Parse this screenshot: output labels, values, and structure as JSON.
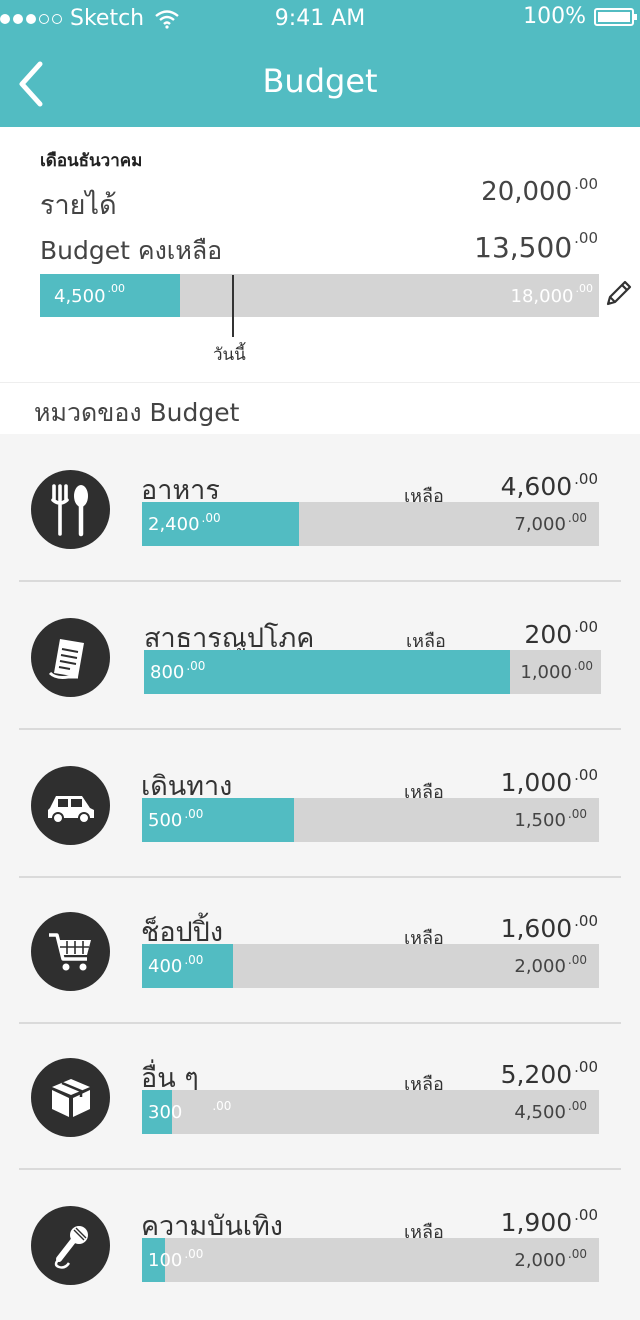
{
  "status_bar": {
    "carrier": "Sketch",
    "time": "9:41 AM",
    "battery": "100%"
  },
  "nav": {
    "title": "Budget",
    "back_icon": "chevron-left-icon"
  },
  "summary": {
    "month": "เดือนธันวาคม",
    "income_label": "รายได้",
    "income_value": "20,000",
    "income_cents": ".00",
    "remaining_label": "Budget คงเหลือ",
    "remaining_value": "13,500",
    "remaining_cents": ".00",
    "spent_value": "4,500",
    "spent_cents": ".00",
    "total_value": "18,000",
    "total_cents": ".00",
    "spent_fraction": 0.25,
    "today_label": "วันนี้",
    "edit_icon": "pencil-icon"
  },
  "section_title": "หมวดของ Budget",
  "remaining_word": "เหลือ",
  "categories": [
    {
      "name": "อาหาร",
      "icon": "fork-spoon-icon",
      "left": "4,600",
      "left_cents": ".00",
      "spent": "2,400",
      "spent_cents": ".00",
      "total": "7,000",
      "total_cents": ".00",
      "fraction": 0.3429
    },
    {
      "name": "สาธารณูปโภค",
      "icon": "bill-receipt-icon",
      "left": "200",
      "left_cents": ".00",
      "spent": "800",
      "spent_cents": ".00",
      "total": "1,000",
      "total_cents": ".00",
      "fraction": 0.8
    },
    {
      "name": "เดินทาง",
      "icon": "car-icon",
      "left": "1,000",
      "left_cents": ".00",
      "spent": "500",
      "spent_cents": ".00",
      "total": "1,500",
      "total_cents": ".00",
      "fraction": 0.3333
    },
    {
      "name": "ช็อปปิ้ง",
      "icon": "shopping-cart-icon",
      "left": "1,600",
      "left_cents": ".00",
      "spent": "400",
      "spent_cents": ".00",
      "total": "2,000",
      "total_cents": ".00",
      "fraction": 0.2
    },
    {
      "name": "อื่น ๆ",
      "icon": "box-icon",
      "left": "5,200",
      "left_cents": ".00",
      "spent": "300",
      "spent_cents": ".00",
      "total": "4,500",
      "total_cents": ".00",
      "fraction": 0.0667
    },
    {
      "name": "ความบันเทิง",
      "icon": "microphone-icon",
      "left": "1,900",
      "left_cents": ".00",
      "spent": "100",
      "spent_cents": ".00",
      "total": "2,000",
      "total_cents": ".00",
      "fraction": 0.05
    }
  ],
  "colors": {
    "accent": "#52bcc2",
    "bar_track": "#d4d4d4",
    "icon_bg": "#2f2f2f"
  }
}
